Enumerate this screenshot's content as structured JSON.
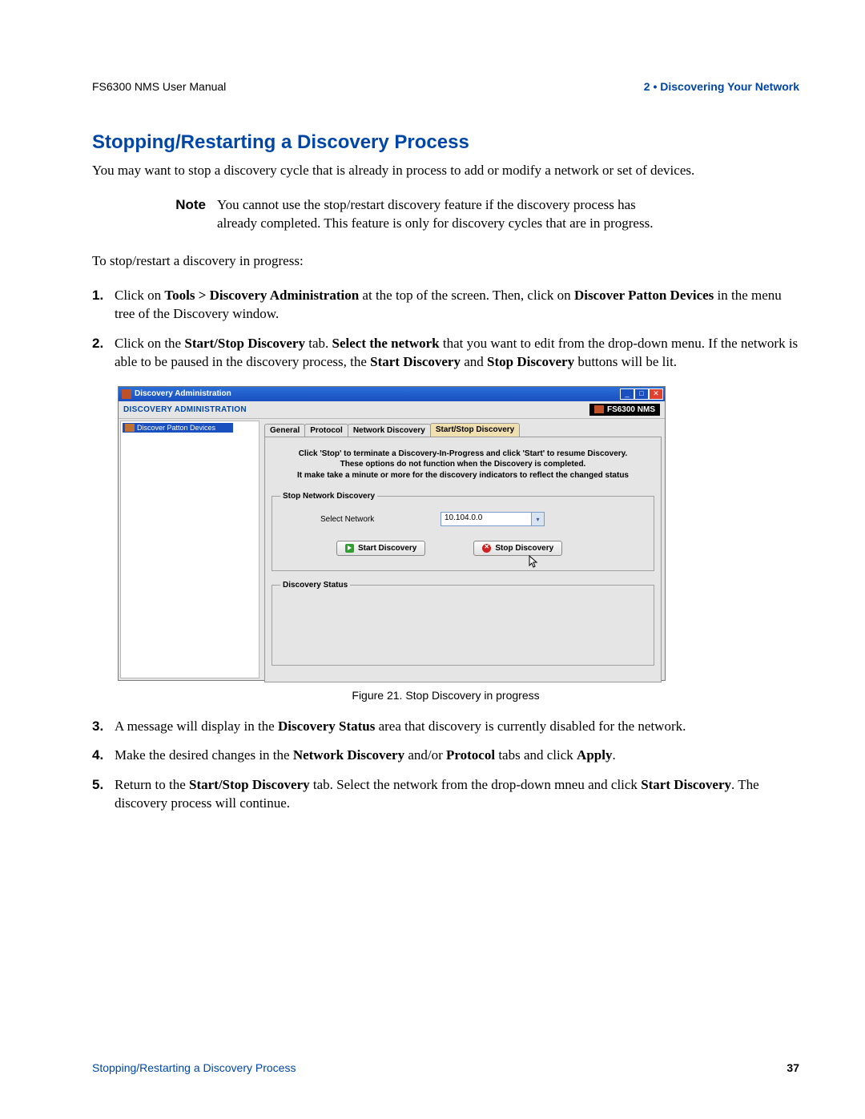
{
  "header": {
    "left": "FS6300 NMS User Manual",
    "right": "2 • Discovering Your Network"
  },
  "title": "Stopping/Restarting a Discovery Process",
  "intro": "You may want to stop a discovery cycle that is already in process to add or modify a network or set of devices.",
  "note": {
    "label": "Note",
    "text": "You cannot use the stop/restart discovery feature if the discovery process has already completed. This feature is only for discovery cycles that are in progress."
  },
  "lead": "To stop/restart a discovery in progress:",
  "steps": {
    "s1a": "Click on ",
    "s1b": "Tools > Discovery Administration",
    "s1c": " at the top of the screen. Then, click on ",
    "s1d": "Discover Patton Devices",
    "s1e": " in the menu tree of the Discovery window.",
    "s2a": "Click on the ",
    "s2b": "Start/Stop Discovery",
    "s2c": " tab. ",
    "s2d": "Select the network",
    "s2e": " that you want to edit from the drop-down menu. If the network is able to be paused in the discovery process, the ",
    "s2f": "Start Discovery",
    "s2g": " and ",
    "s2h": "Stop Discovery",
    "s2i": " buttons will be lit.",
    "s3a": "A message will display in the ",
    "s3b": "Discovery Status",
    "s3c": " area that discovery is currently disabled for the network.",
    "s4a": "Make the desired changes in the ",
    "s4b": "Network Discovery",
    "s4c": " and/or ",
    "s4d": "Protocol",
    "s4e": " tabs and click ",
    "s4f": "Apply",
    "s4g": ".",
    "s5a": "Return to the ",
    "s5b": "Start/Stop Discovery",
    "s5c": " tab. Select the network from the drop-down mneu and click ",
    "s5d": "Start Discovery",
    "s5e": ". The discovery process will continue."
  },
  "screenshot": {
    "window_title": "Discovery Administration",
    "toolbar_label": "DISCOVERY ADMINISTRATION",
    "brand": "FS6300 NMS",
    "tree_item": "Discover Patton Devices",
    "tabs": {
      "general": "General",
      "protocol": "Protocol",
      "network": "Network Discovery",
      "startstop": "Start/Stop Discovery"
    },
    "hint1": "Click 'Stop' to terminate a Discovery-In-Progress and click 'Start' to resume Discovery.",
    "hint2": "These options do not function when the Discovery is completed.",
    "hint3": "It make take a minute or more for the discovery indicators to reflect the changed status",
    "fieldset1": "Stop Network Discovery",
    "select_label": "Select Network",
    "network_value": "10.104.0.0",
    "start_btn": "Start Discovery",
    "stop_btn": "Stop Discovery",
    "fieldset2": "Discovery Status"
  },
  "caption": "Figure 21. Stop Discovery in progress",
  "footer": {
    "left": "Stopping/Restarting a Discovery Process",
    "right": "37"
  }
}
